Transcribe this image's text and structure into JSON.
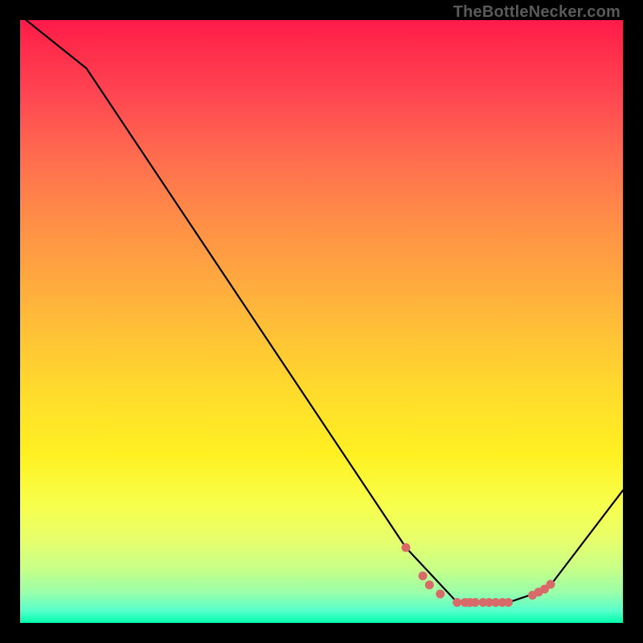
{
  "attribution": "TheBottleNecker.com",
  "chart_data": {
    "type": "line",
    "title": "",
    "xlabel": "",
    "ylabel": "",
    "xlim": [
      0,
      100
    ],
    "ylim": [
      0,
      100
    ],
    "grid": false,
    "series": [
      {
        "name": "curve",
        "x": [
          1,
          11,
          64,
          72.5,
          81,
          87.5,
          100
        ],
        "y": [
          100,
          92,
          12.5,
          3.4,
          3.4,
          5.6,
          22
        ],
        "color": "#000000"
      }
    ],
    "markers": [
      {
        "name": "dots",
        "color": "#d86a6a",
        "points": [
          {
            "x": 64.0,
            "y": 12.5
          },
          {
            "x": 66.8,
            "y": 7.8
          },
          {
            "x": 67.9,
            "y": 6.3
          },
          {
            "x": 69.7,
            "y": 4.8
          },
          {
            "x": 72.5,
            "y": 3.4
          },
          {
            "x": 73.8,
            "y": 3.4
          },
          {
            "x": 74.6,
            "y": 3.4
          },
          {
            "x": 75.5,
            "y": 3.4
          },
          {
            "x": 76.8,
            "y": 3.4
          },
          {
            "x": 77.8,
            "y": 3.4
          },
          {
            "x": 78.9,
            "y": 3.4
          },
          {
            "x": 80.0,
            "y": 3.4
          },
          {
            "x": 81.0,
            "y": 3.4
          },
          {
            "x": 85.0,
            "y": 4.6
          },
          {
            "x": 86.0,
            "y": 5.1
          },
          {
            "x": 87.0,
            "y": 5.6
          },
          {
            "x": 88.0,
            "y": 6.4
          }
        ]
      }
    ],
    "background": {
      "type": "vertical-gradient",
      "stops": [
        {
          "pos": 0.0,
          "color": "#ff1a4a"
        },
        {
          "pos": 0.5,
          "color": "#ffc236"
        },
        {
          "pos": 0.8,
          "color": "#f8ff4a"
        },
        {
          "pos": 1.0,
          "color": "#00ffaa"
        }
      ]
    }
  }
}
